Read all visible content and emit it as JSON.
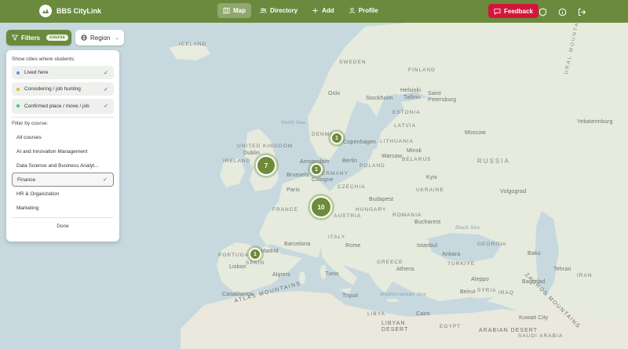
{
  "app": {
    "name": "BBS CityLink"
  },
  "nav": {
    "items": [
      {
        "label": "Map",
        "icon": "map-icon",
        "active": true
      },
      {
        "label": "Directory",
        "icon": "users-icon",
        "active": false
      },
      {
        "label": "Add",
        "icon": "plus-icon",
        "active": false
      },
      {
        "label": "Profile",
        "icon": "user-icon",
        "active": false
      }
    ],
    "feedback_label": "Feedback"
  },
  "controls": {
    "filters_label": "Filters",
    "filters_badge": "course",
    "region_label": "Region"
  },
  "panel": {
    "status_heading": "Show cities where students:",
    "statuses": [
      {
        "label": "Lived here",
        "color": "#5b8def",
        "checked": true
      },
      {
        "label": "Considering / job hunting",
        "color": "#f0b429",
        "checked": true
      },
      {
        "label": "Confirmed place / move / job",
        "color": "#37c77a",
        "checked": true
      }
    ],
    "course_heading": "Filter by course:",
    "courses": [
      {
        "label": "All courses",
        "selected": false
      },
      {
        "label": "AI and Innovation Management",
        "selected": false
      },
      {
        "label": "Data Science and Business Analyt...",
        "selected": false
      },
      {
        "label": "Finance",
        "selected": true
      },
      {
        "label": "HR & Organization",
        "selected": false
      },
      {
        "label": "Marketing",
        "selected": false
      }
    ],
    "done_label": "Done"
  },
  "map": {
    "clusters": [
      "1",
      "7",
      "1",
      "10",
      "1"
    ],
    "labels": {
      "iceland": "ICELAND",
      "sweden": "SWEDEN",
      "finland": "FINLAND",
      "oslo": "Oslo",
      "stockholm": "Stockholm",
      "helsinki": "Helsinki",
      "tallinn": "Tallinn",
      "st_petersburg": "Saint Petersburg",
      "estonia": "ESTONIA",
      "latvia": "LATVIA",
      "lithuania": "LITHUANIA",
      "denmark": "DENMARK",
      "copenhagen": "Copenhagen",
      "north_sea": "North Sea",
      "uk": "UNITED KINGDOM",
      "ireland": "IRELAND",
      "dublin": "Dublin",
      "amsterdam": "Amsterdam",
      "brussels": "Brussels",
      "cologne": "Cologne",
      "germany": "GERMANY",
      "berlin": "Berlin",
      "poland": "POLAND",
      "warsaw": "Warsaw",
      "minsk": "Minsk",
      "belarus": "BELARUS",
      "moscow": "Moscow",
      "russia": "RUSSIA",
      "ural": "URAL MOUNTAINS",
      "yekaterinburg": "Yekaterinburg",
      "ukraine": "UKRAINE",
      "kyiv": "Kyiv",
      "czechia": "CZECHIA",
      "paris": "Paris",
      "france": "FRANCE",
      "austria": "AUSTRIA",
      "hungary": "HUNGARY",
      "budapest": "Budapest",
      "romania": "ROMANIA",
      "bucharest": "Bucharest",
      "volgograd": "Volgograd",
      "italy": "ITALY",
      "rome": "Rome",
      "barcelona": "Barcelona",
      "spain": "SPAIN",
      "portugal": "PORTUGAL",
      "madrid": "Madrid",
      "lisbon": "Lisbon",
      "algiers": "Algiers",
      "tunis": "Tunis",
      "greece": "GREECE",
      "athens": "Athens",
      "istanbul": "Istanbul",
      "ankara": "Ankara",
      "turkiye": "TÜRKIYE",
      "black_sea": "Black Sea",
      "georgia": "GEORGIA",
      "baku": "Baku",
      "casablanca": "Casablanca",
      "atlas": "ATLAS MOUNTAINS",
      "tripoli": "Tripoli",
      "libyan_desert": "LIBYAN DESERT",
      "cairo": "Cairo",
      "tehran": "Tehran",
      "iran": "IRAN",
      "iraq": "IRAQ",
      "zagros": "ZAGROS MOUNTAINS",
      "baghdad": "Baghdad",
      "kuwait": "Kuwait City",
      "aleppo": "Aleppo",
      "beirut": "Beirut",
      "syria": "SYRIA",
      "mediterranean": "Mediterranean Sea",
      "libya": "LIBYA",
      "egypt": "EGYPT",
      "arabian_desert": "ARABIAN DESERT",
      "saudi_arabia": "SAUDI ARABIA"
    }
  }
}
